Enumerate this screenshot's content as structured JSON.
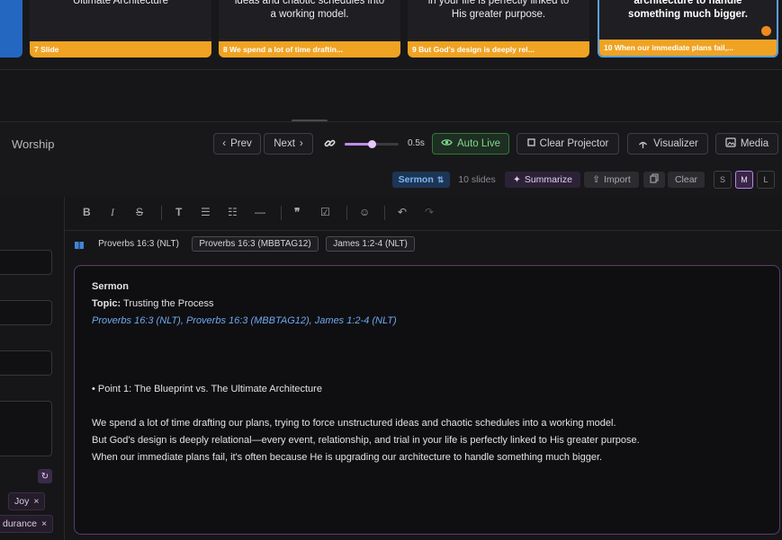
{
  "slides": [
    {
      "text": "Ultimate Architecture",
      "label": "7 Slide"
    },
    {
      "text": "ideas and chaotic schedules into a working model.",
      "label": "8 We spend a lot of time draftin..."
    },
    {
      "text": "in your life is perfectly linked to His greater purpose.",
      "label": "9 But God's design is deeply rel..."
    },
    {
      "text": "architecture to handle something much bigger.",
      "label": "10 When our immediate plans fail,..."
    }
  ],
  "worship": {
    "title": "Worship"
  },
  "controls": {
    "prev": "Prev",
    "next": "Next",
    "speed": "0.5s",
    "auto_live": "Auto Live",
    "clear_projector": "Clear Projector",
    "visualizer": "Visualizer",
    "media": "Media",
    "slider_level": 0.5
  },
  "sermon_bar": {
    "mode": "Sermon",
    "count": "10 slides",
    "summarize": "Summarize",
    "import": "Import",
    "clear": "Clear",
    "sizes": [
      "S",
      "M",
      "L"
    ],
    "selected_size": "M"
  },
  "left_panel": {
    "tags": [
      {
        "label": "Joy"
      },
      {
        "label": "durance"
      }
    ]
  },
  "references": [
    "Proverbs 16:3 (NLT)",
    "Proverbs 16:3 (MBBTAG12)",
    "James 1:2-4 (NLT)"
  ],
  "document": {
    "heading": "Sermon",
    "topic_label": "Topic:",
    "topic": "Trusting the Process",
    "refs_line": "Proverbs 16:3 (NLT), Proverbs 16:3 (MBBTAG12), James 1:2-4 (NLT)",
    "point": "• Point 1: The Blueprint vs. The Ultimate Architecture",
    "lines": [
      "We spend a lot of time drafting our plans, trying to force unstructured ideas and chaotic schedules into a working model.",
      "But God's design is deeply relational—every event, relationship, and trial in your life is perfectly linked to His greater purpose.",
      "When our immediate plans fail, it's often because He is upgrading our architecture to handle something much bigger."
    ]
  },
  "colors": {
    "accent": "#f0a323",
    "selected_border": "#5a9fe0",
    "purple": "#b886e0"
  }
}
